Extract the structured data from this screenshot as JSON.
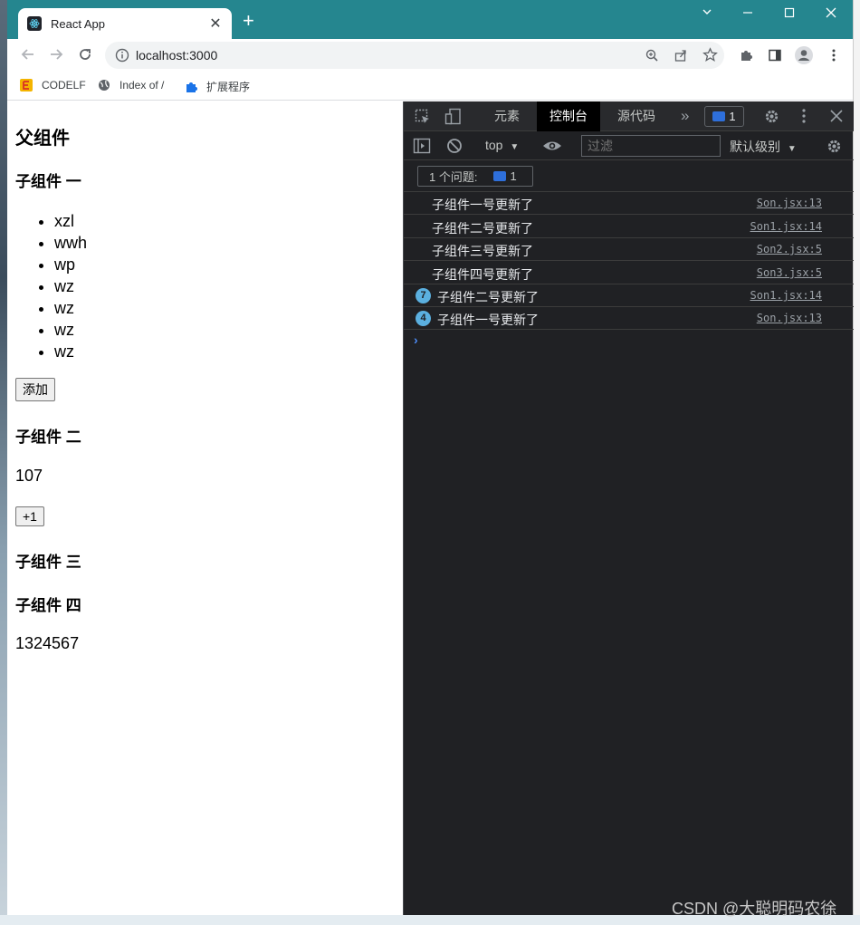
{
  "browser": {
    "tab_title": "React App",
    "tab_close": "✕",
    "new_tab": "+",
    "url": "localhost:3000",
    "bookmarks": [
      "CODELF",
      "Index of /",
      "扩展程序"
    ]
  },
  "page": {
    "parent_title": "父组件",
    "child1_title": "子组件 一",
    "list_items": [
      "xzl",
      "wwh",
      "wp",
      "wz",
      "wz",
      "wz",
      "wz"
    ],
    "add_button": "添加",
    "child2_title": "子组件 二",
    "counter_value": "107",
    "increment_button": "+1",
    "child3_title": "子组件 三",
    "child4_title": "子组件 四",
    "child4_value": "1324567"
  },
  "devtools": {
    "tabs": [
      "元素",
      "控制台",
      "源代码"
    ],
    "more": "»",
    "message_count": "1",
    "context": "top",
    "filter_placeholder": "过滤",
    "level": "默认级别",
    "issues_label": "1 个问题:",
    "issues_count": "1",
    "logs": [
      {
        "message": "子组件一号更新了",
        "source": "Son.jsx:13",
        "count": ""
      },
      {
        "message": "子组件二号更新了",
        "source": "Son1.jsx:14",
        "count": ""
      },
      {
        "message": "子组件三号更新了",
        "source": "Son2.jsx:5",
        "count": ""
      },
      {
        "message": "子组件四号更新了",
        "source": "Son3.jsx:5",
        "count": ""
      },
      {
        "message": "子组件二号更新了",
        "source": "Son1.jsx:14",
        "count": "7"
      },
      {
        "message": "子组件一号更新了",
        "source": "Son.jsx:13",
        "count": "4"
      }
    ],
    "prompt": "›"
  },
  "watermark": "CSDN @大聪明码农徐"
}
